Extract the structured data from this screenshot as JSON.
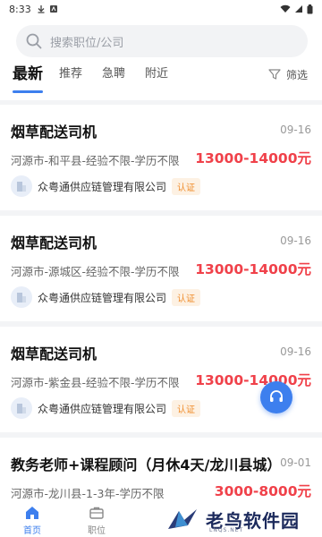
{
  "status": {
    "time": "8:33"
  },
  "search": {
    "placeholder": "搜索职位/公司"
  },
  "tabs": [
    {
      "label": "最新"
    },
    {
      "label": "推荐"
    },
    {
      "label": "急聘"
    },
    {
      "label": "附近"
    }
  ],
  "filter": {
    "label": "筛选"
  },
  "jobs": [
    {
      "title": "烟草配送司机",
      "date": "09-16",
      "meta": "河源市-和平县-经验不限-学历不限",
      "salary": "13000-14000元",
      "company": "众粤通供应链管理有限公司",
      "badge": "认证"
    },
    {
      "title": "烟草配送司机",
      "date": "09-16",
      "meta": "河源市-源城区-经验不限-学历不限",
      "salary": "13000-14000元",
      "company": "众粤通供应链管理有限公司",
      "badge": "认证"
    },
    {
      "title": "烟草配送司机",
      "date": "09-16",
      "meta": "河源市-紫金县-经验不限-学历不限",
      "salary": "13000-14000元",
      "company": "众粤通供应链管理有限公司",
      "badge": "认证"
    },
    {
      "title": "教务老师+课程顾问（月休4天/龙川县城）",
      "date": "09-01",
      "meta": "河源市-龙川县-1-3年-学历不限",
      "salary": "3000-8000元",
      "company": "",
      "badge": ""
    }
  ],
  "bottom_nav": [
    {
      "label": "首页",
      "active": true
    },
    {
      "label": "职位",
      "active": false
    }
  ],
  "watermark": {
    "text": "老鸟软件园",
    "sub": "LNQS.NET"
  },
  "colors": {
    "accent": "#3d7fee",
    "salary": "#f0414a",
    "badge": "#f08c2a"
  }
}
